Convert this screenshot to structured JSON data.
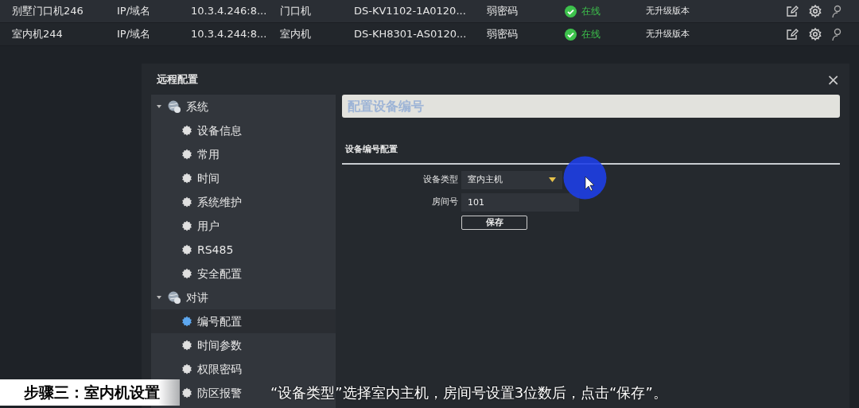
{
  "devices": [
    {
      "name": "别墅门口机246",
      "address_type": "IP/域名",
      "address": "10.3.4.246:8...",
      "device_type": "门口机",
      "model": "DS-KV1102-1A0120...",
      "security": "弱密码",
      "status": "在线",
      "online": true,
      "upgrade": "无升级版本"
    },
    {
      "name": "室内机244",
      "address_type": "IP/域名",
      "address": "10.3.4.244:8...",
      "device_type": "室内机",
      "model": "DS-KH8301-AS0120...",
      "security": "弱密码",
      "status": "在线",
      "online": true,
      "upgrade": "无升级版本"
    }
  ],
  "dialog": {
    "title": "远程配置",
    "close": "×",
    "tree": [
      {
        "label": "系统",
        "expanded": true,
        "children": [
          {
            "label": "设备信息",
            "selected": false
          },
          {
            "label": "常用",
            "selected": false
          },
          {
            "label": "时间",
            "selected": false
          },
          {
            "label": "系统维护",
            "selected": false
          },
          {
            "label": "用户",
            "selected": false
          },
          {
            "label": "RS485",
            "selected": false
          },
          {
            "label": "安全配置",
            "selected": false
          }
        ]
      },
      {
        "label": "对讲",
        "expanded": true,
        "children": [
          {
            "label": "编号配置",
            "selected": true
          },
          {
            "label": "时间参数",
            "selected": false
          },
          {
            "label": "权限密码",
            "selected": false
          },
          {
            "label": "防区报警",
            "selected": false
          }
        ]
      }
    ],
    "header": "配置设备编号",
    "section_title": "设备编号配置",
    "fields": [
      {
        "kind": "select",
        "label": "设备类型",
        "value": "室内主机"
      },
      {
        "kind": "text",
        "label": "房间号",
        "value": "101"
      }
    ],
    "save_button": "保存"
  },
  "subtitle": {
    "step": "步骤三：室内机设置",
    "caption": "“设备类型”选择室内主机，房间号设置3位数后，点击“保存”。"
  }
}
